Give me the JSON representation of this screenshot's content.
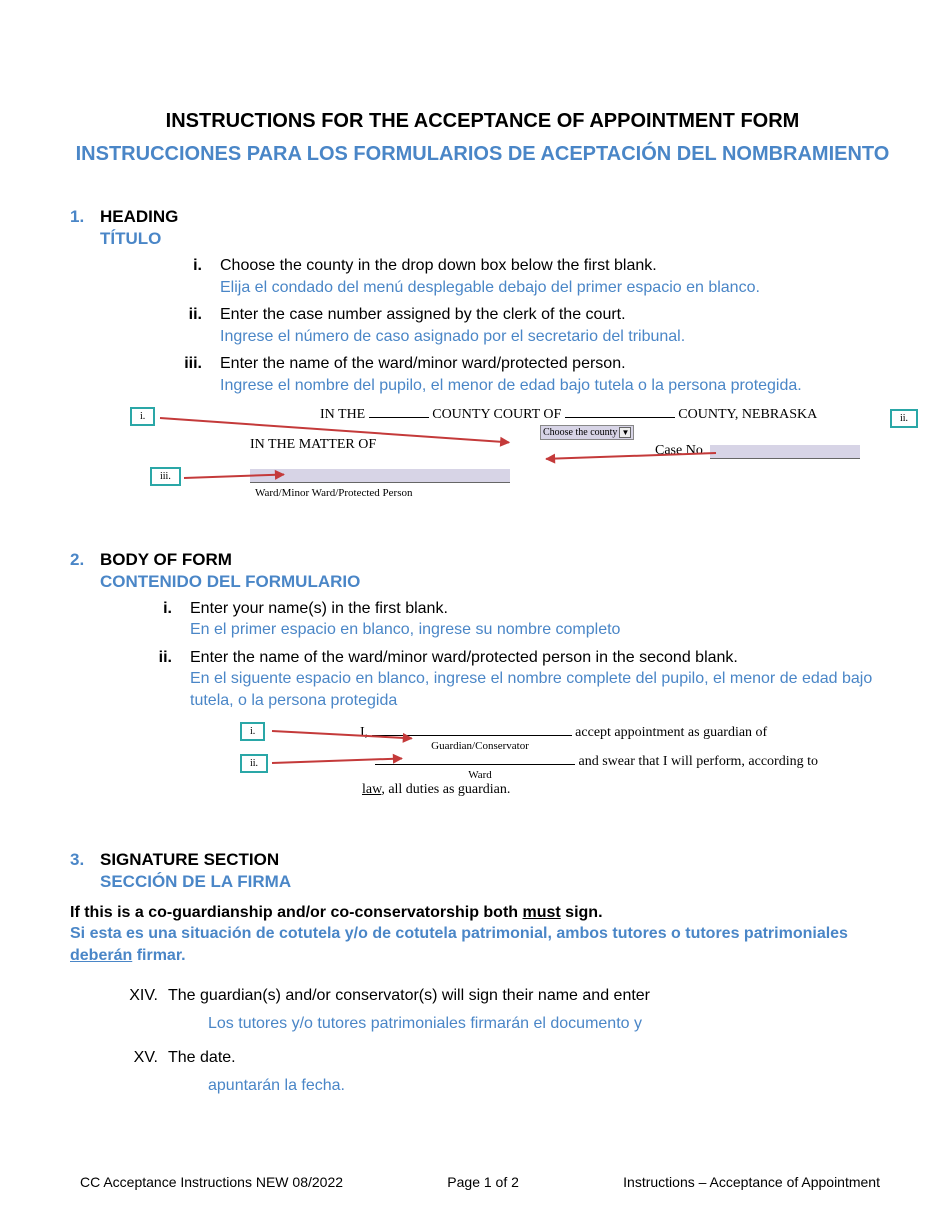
{
  "title_en": "INSTRUCTIONS FOR THE ACCEPTANCE OF APPOINTMENT FORM",
  "title_es": "INSTRUCCIONES PARA LOS FORMULARIOS DE ACEPTACIÓN DEL NOMBRAMIENTO",
  "sections": {
    "heading": {
      "num": "1.",
      "label_en": "HEADING",
      "label_es": "TÍTULO",
      "items": [
        {
          "roman": "i.",
          "en": "Choose the county in the drop down box below the first blank.",
          "es": "Elija el condado del menú desplegable debajo del primer espacio en blanco."
        },
        {
          "roman": "ii.",
          "en": "Enter the case number assigned by the clerk of the court.",
          "es": "Ingrese el número de caso asignado por el secretario del tribunal."
        },
        {
          "roman": "iii.",
          "en": "Enter the name of the ward/minor ward/protected person.",
          "es": "Ingrese el nombre del pupilo, el menor de edad bajo tutela o la persona protegida."
        }
      ]
    },
    "body": {
      "num": "2.",
      "label_en": "BODY OF FORM",
      "label_es": "CONTENIDO DEL FORMULARIO",
      "items": [
        {
          "roman": "i.",
          "en": "Enter your name(s) in the first blank.",
          "es": "En el primer espacio en blanco, ingrese su nombre completo"
        },
        {
          "roman": "ii.",
          "en": "Enter the name of the ward/minor ward/protected person in the second blank.",
          "es": "En el siguente espacio en blanco, ingrese el nombre complete del pupilo, el menor de edad bajo tutela, o la persona protegida"
        }
      ]
    },
    "signature": {
      "num": "3.",
      "label_en": "SIGNATURE SECTION",
      "label_es": "SECCIÓN DE LA FIRMA",
      "co_en_pre": "If this is a co-guardianship and/or co-conservatorship both ",
      "co_en_must": "must",
      "co_en_post": " sign.",
      "co_es_pre": "Si esta es una situación de cotutela y/o de cotutela patrimonial, ambos tutores o tutores patrimoniales ",
      "co_es_must": "deberán",
      "co_es_post": " firmar.",
      "xiv_en": "The guardian(s) and/or conservator(s) will sign their name and enter",
      "xiv_es": "Los tutores y/o tutores patrimoniales firmarán el documento y",
      "xv_en": "The date.",
      "xv_es": "apuntarán la fecha.",
      "xiv_roman": "XIV.",
      "xv_roman": "XV."
    }
  },
  "diagram1": {
    "in_the": "IN THE",
    "county_court_of": "COUNTY COURT OF",
    "county_ne": "COUNTY, NEBRASKA",
    "in_matter": "IN THE MATTER OF",
    "case_no": "Case No.",
    "dropdown": "Choose the county",
    "ward_label": "Ward/Minor Ward/Protected Person",
    "callouts": {
      "i": "i.",
      "ii": "ii.",
      "iii": "iii."
    }
  },
  "diagram2": {
    "i_text": "I,",
    "accept": "accept appointment as guardian of",
    "guardian_label": "Guardian/Conservator",
    "and_swear": "and swear that I will perform, according to",
    "ward_label": "Ward",
    "law_line_pre": "law",
    "law_line_post": ", all duties as guardian.",
    "callouts": {
      "i": "i.",
      "ii": "ii."
    }
  },
  "footer": {
    "left": "CC Acceptance Instructions NEW 08/2022",
    "center": "Page 1 of 2",
    "right": "Instructions – Acceptance of Appointment"
  }
}
